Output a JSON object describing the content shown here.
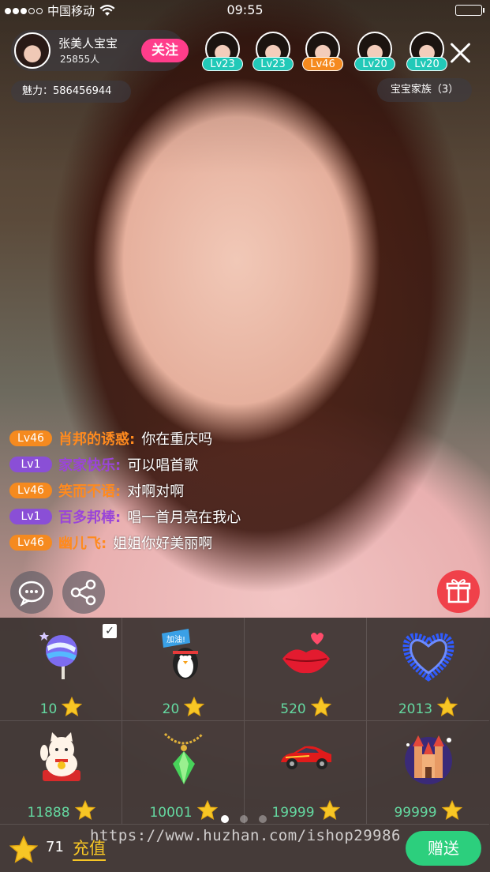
{
  "status_bar": {
    "carrier": "中国移动",
    "time": "09:55"
  },
  "host": {
    "name": "张美人宝宝",
    "fans": "25855人",
    "follow_label": "关注"
  },
  "charm": "魅力：586456944",
  "family": "宝宝家族（3）",
  "viewers": [
    {
      "level": "Lv23",
      "color": "teal"
    },
    {
      "level": "Lv23",
      "color": "teal"
    },
    {
      "level": "Lv46",
      "color": "orange"
    },
    {
      "level": "Lv20",
      "color": "teal"
    },
    {
      "level": "Lv20",
      "color": "teal"
    }
  ],
  "chat": [
    {
      "level": "Lv46",
      "level_color": "orange",
      "user": "肖邦的诱惑:",
      "text": "你在重庆吗"
    },
    {
      "level": "Lv1",
      "level_color": "purple",
      "user": "家家快乐:",
      "text": "可以唱首歌"
    },
    {
      "level": "Lv46",
      "level_color": "orange",
      "user": "笑而不语:",
      "text": "对啊对啊"
    },
    {
      "level": "Lv1",
      "level_color": "purple",
      "user": "百多邦棒:",
      "text": "唱一首月亮在我心"
    },
    {
      "level": "Lv46",
      "level_color": "orange",
      "user": "幽儿飞:",
      "text": "姐姐你好美丽啊"
    }
  ],
  "gifts": [
    {
      "icon": "lollipop-icon",
      "price": "10",
      "selected": true
    },
    {
      "icon": "penguin-flag-icon",
      "price": "20",
      "flag_text": "加油!"
    },
    {
      "icon": "kiss-lips-icon",
      "price": "520"
    },
    {
      "icon": "flower-heart-icon",
      "price": "2013"
    },
    {
      "icon": "lucky-cat-icon",
      "price": "11888"
    },
    {
      "icon": "gem-pendant-icon",
      "price": "10001"
    },
    {
      "icon": "sports-car-icon",
      "price": "19999"
    },
    {
      "icon": "castle-icon",
      "price": "99999"
    }
  ],
  "footer": {
    "balance": "71",
    "recharge_label": "充值",
    "send_label": "赠送"
  },
  "watermark": "https://www.huzhan.com/ishop29986",
  "colors": {
    "follow": "#ff3d8b",
    "send": "#2ccf7d",
    "gift_button": "#f0414a",
    "price": "#64d8a0",
    "level_orange": "#f58a1f",
    "level_teal": "#22c9b8",
    "level_purple": "#8a4fd6"
  }
}
